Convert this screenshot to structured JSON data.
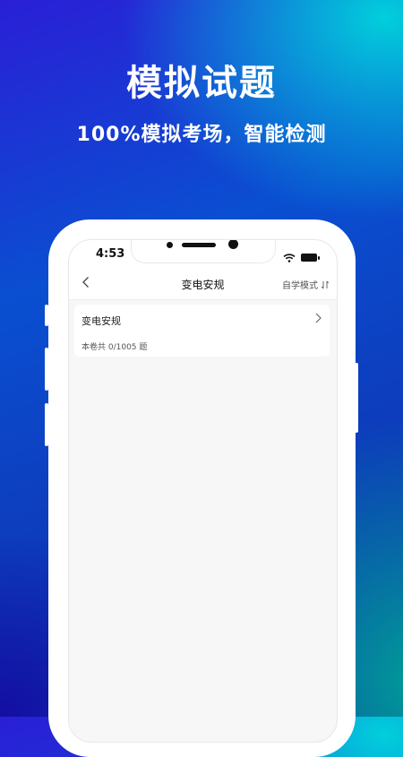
{
  "promo": {
    "headline": "模拟试题",
    "subline": "100%模拟考场，智能检测"
  },
  "status_bar": {
    "time": "4:53"
  },
  "nav": {
    "title": "变电安规",
    "mode_label": "自学模式"
  },
  "exam_card": {
    "title": "变电安规",
    "count_text": "本卷共 0/1005 题"
  },
  "icons": {
    "back": "chevron-left-icon",
    "sort": "sort-arrows-icon",
    "chevron": "chevron-right-icon",
    "wifi": "wifi-icon",
    "battery": "battery-icon"
  },
  "colors": {
    "bg_start": "#2a1fd6",
    "bg_accent_teal": "#00d7dc",
    "phone_frame": "#ffffff",
    "screen_bg": "#f7f7f7"
  }
}
